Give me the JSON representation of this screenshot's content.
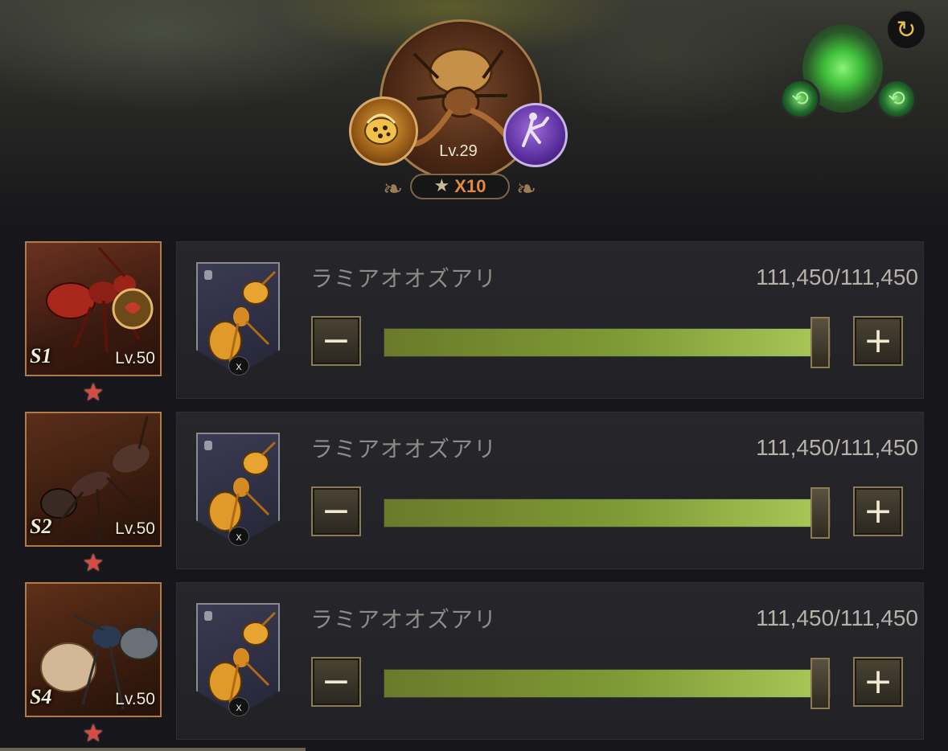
{
  "commander": {
    "level": "Lv.29",
    "star_count": "X10"
  },
  "rows": [
    {
      "tier": "S1",
      "level": "Lv.50",
      "troop_name": "ラミアオオズアリ",
      "count": "111,450/111,450",
      "fill_fraction": 1.0,
      "troop_badge": "x"
    },
    {
      "tier": "S2",
      "level": "Lv.50",
      "troop_name": "ラミアオオズアリ",
      "count": "111,450/111,450",
      "fill_fraction": 1.0,
      "troop_badge": "x"
    },
    {
      "tier": "S4",
      "level": "Lv.50",
      "troop_name": "ラミアオオズアリ",
      "count": "111,450/111,450",
      "fill_fraction": 1.0,
      "troop_badge": "x"
    }
  ],
  "icons": {
    "refresh": "refresh-icon",
    "energy": "spiral-energy-icon",
    "minus": "minus-icon",
    "plus": "plus-icon",
    "star": "star-icon"
  },
  "colors": {
    "slider_fill": "#a6c557",
    "star_red": "#d94b42",
    "star_count": "#e48a3a",
    "card_border": "#b07a4a"
  }
}
